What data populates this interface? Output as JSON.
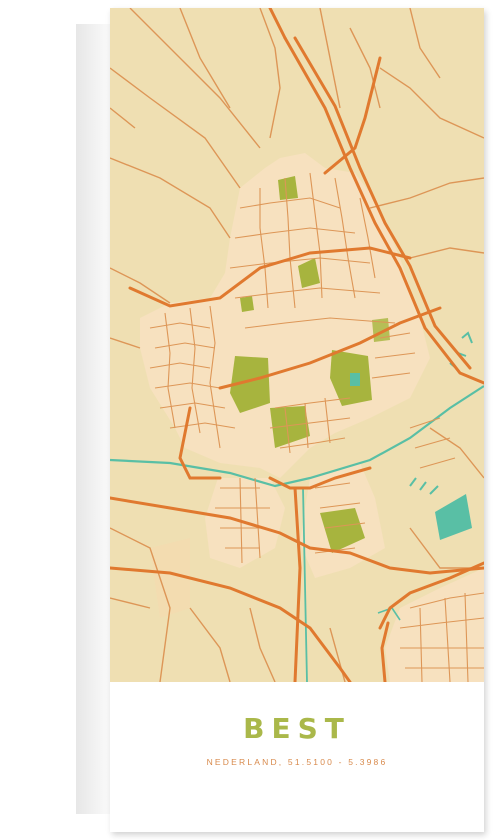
{
  "poster": {
    "city": "BEST",
    "subtitle": "NEDERLAND, 51.5100 - 5.3986"
  },
  "colors": {
    "background": "#efdfb2",
    "major_road": "#e0792f",
    "minor_road": "#dd9657",
    "urban_block": "#f7e1bf",
    "park": "#a7b43e",
    "water": "#59bfa5",
    "title": "#aab84a",
    "subtitle": "#d88a4c"
  }
}
